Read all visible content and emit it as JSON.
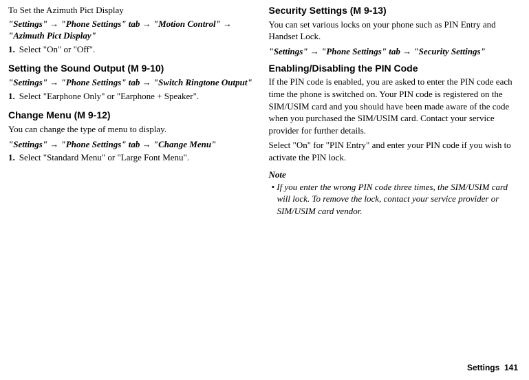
{
  "left": {
    "azimuth": {
      "title": "To Set the Azimuth Pict Display",
      "path": "\"Settings\" → \"Phone Settings\" tab → \"Motion Control\" → \"Azimuth Pict Display\"",
      "stepNum": "1.",
      "stepText": "Select \"On\" or \"Off\"."
    },
    "sound": {
      "title": "Setting the Sound Output",
      "mtag": "(M 9-10)",
      "path": " \"Settings\" → \"Phone Settings\" tab → \"Switch Ringtone Output\"",
      "stepNum": "1.",
      "stepText": "Select \"Earphone Only\" or \"Earphone + Speaker\"."
    },
    "menu": {
      "title": "Change Menu",
      "mtag": "(M 9-12)",
      "intro": "You can change the type of menu to display.",
      "path": " \"Settings\" → \"Phone Settings\" tab → \"Change Menu\"",
      "stepNum": "1.",
      "stepText": "Select \"Standard Menu\" or \"Large Font Menu\"."
    }
  },
  "right": {
    "security": {
      "title": "Security Settings",
      "mtag": "(M 9-13)",
      "intro": "You can set various locks on your phone such as PIN Entry and Handset Lock.",
      "path": " \"Settings\" → \"Phone Settings\" tab  → \"Security Settings\""
    },
    "pin": {
      "title": "Enabling/Disabling the PIN Code",
      "p1": "If the PIN code is enabled, you are asked to enter the PIN code each time the phone is switched on. Your PIN code is registered on the SIM/USIM card and you should have been made aware of the code when you purchased the SIM/USIM card. Contact your service provider for further details.",
      "p2": "Select \"On\" for \"PIN Entry\" and enter your PIN code if you wish to activate the PIN lock."
    },
    "note": {
      "label": "Note",
      "body": "• If you enter the wrong PIN code three times, the SIM/USIM card will lock. To remove the lock, contact your service provider or SIM/USIM card vendor."
    }
  },
  "footer": {
    "section": "Settings",
    "page": "141"
  }
}
